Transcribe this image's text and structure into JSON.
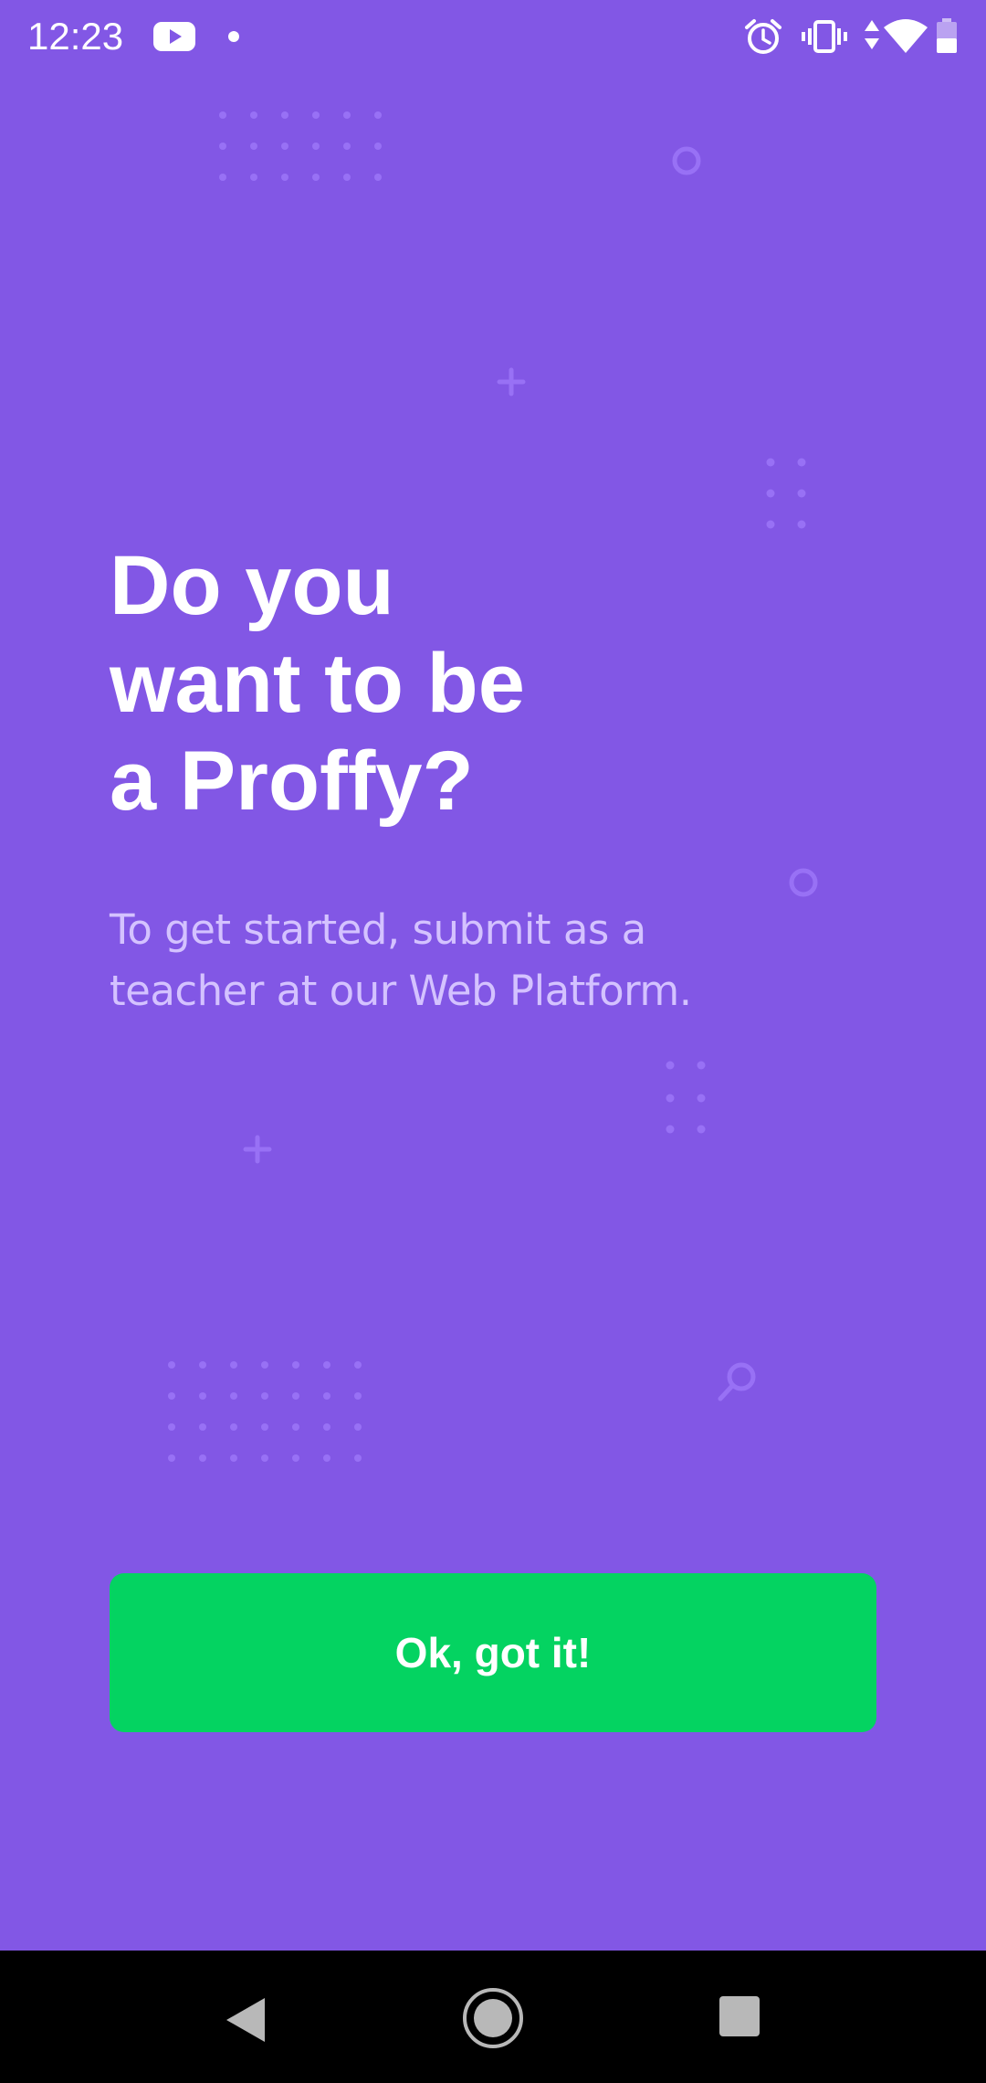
{
  "status_bar": {
    "time": "12:23",
    "icons": [
      "youtube-icon",
      "notification-dot-icon",
      "alarm-icon",
      "vibrate-icon",
      "data-arrows-icon",
      "wifi-icon",
      "battery-icon"
    ]
  },
  "content": {
    "title": " Do you\nwant to be\na Proffy?",
    "subtitle": "To get started, submit as a\nteacher at our Web Platform.",
    "button_label": "Ok, got it!"
  },
  "colors": {
    "background": "#8257E5",
    "title": "#FFFFFF",
    "subtitle": "#D4C2FF",
    "button": "#04D361",
    "decoration": "#9871F5",
    "nav_bar": "#000000"
  },
  "nav_bar": {
    "icons": [
      "back-icon",
      "home-icon",
      "recents-icon"
    ]
  }
}
